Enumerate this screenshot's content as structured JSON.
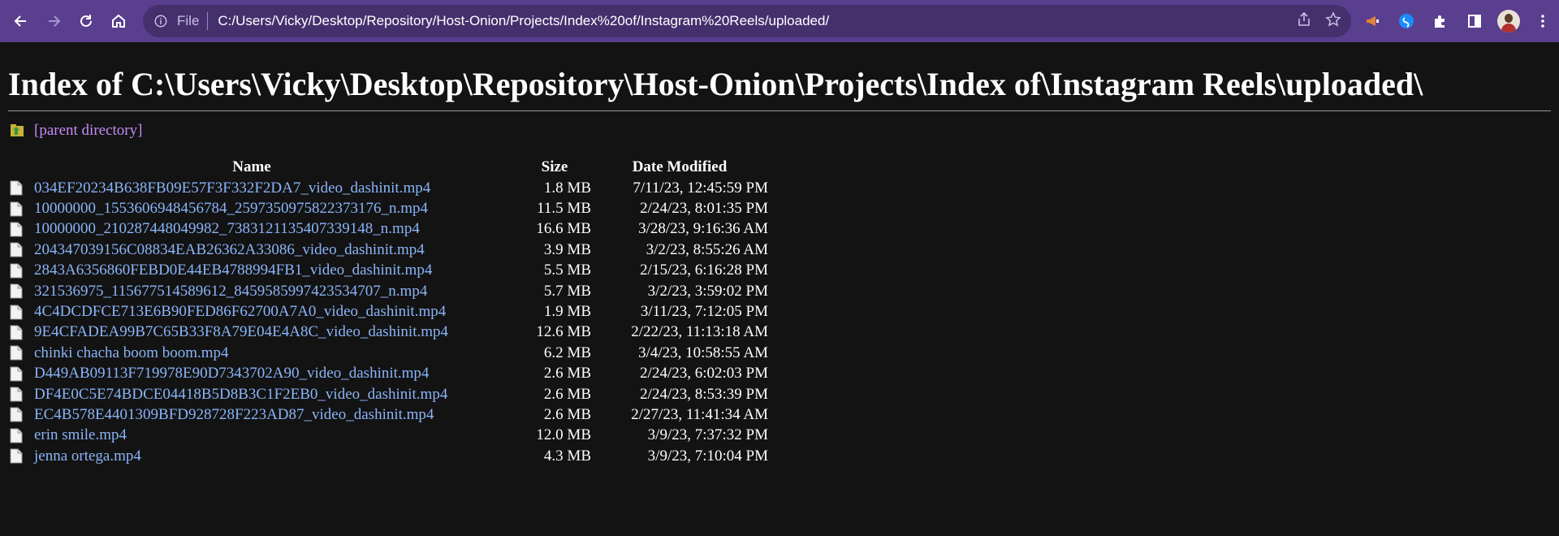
{
  "browser": {
    "url_scheme": "File",
    "url": "C:/Users/Vicky/Desktop/Repository/Host-Onion/Projects/Index%20of/Instagram%20Reels/uploaded/",
    "icons": [
      "back-icon",
      "forward-icon",
      "reload-icon",
      "home-icon",
      "info-icon",
      "share-icon",
      "star-icon",
      "extension-megaphone-icon",
      "extension-shazam-icon",
      "puzzle-icon",
      "side-panel-icon",
      "avatar",
      "kebab-menu-icon"
    ]
  },
  "page": {
    "heading": "Index of C:\\Users\\Vicky\\Desktop\\Repository\\Host-Onion\\Projects\\Index of\\Instagram Reels\\uploaded\\",
    "parent_link": "[parent directory]",
    "columns": {
      "name": "Name",
      "size": "Size",
      "date": "Date Modified"
    },
    "files": [
      {
        "name": "034EF20234B638FB09E57F3F332F2DA7_video_dashinit.mp4",
        "size": "1.8 MB",
        "date": "7/11/23, 12:45:59 PM"
      },
      {
        "name": "10000000_1553606948456784_2597350975822373176_n.mp4",
        "size": "11.5 MB",
        "date": "2/24/23, 8:01:35 PM"
      },
      {
        "name": "10000000_210287448049982_7383121135407339148_n.mp4",
        "size": "16.6 MB",
        "date": "3/28/23, 9:16:36 AM"
      },
      {
        "name": "204347039156C08834EAB26362A33086_video_dashinit.mp4",
        "size": "3.9 MB",
        "date": "3/2/23, 8:55:26 AM"
      },
      {
        "name": "2843A6356860FEBD0E44EB4788994FB1_video_dashinit.mp4",
        "size": "5.5 MB",
        "date": "2/15/23, 6:16:28 PM"
      },
      {
        "name": "321536975_115677514589612_8459585997423534707_n.mp4",
        "size": "5.7 MB",
        "date": "3/2/23, 3:59:02 PM"
      },
      {
        "name": "4C4DCDFCE713E6B90FED86F62700A7A0_video_dashinit.mp4",
        "size": "1.9 MB",
        "date": "3/11/23, 7:12:05 PM"
      },
      {
        "name": "9E4CFADEA99B7C65B33F8A79E04E4A8C_video_dashinit.mp4",
        "size": "12.6 MB",
        "date": "2/22/23, 11:13:18 AM"
      },
      {
        "name": "chinki chacha boom boom.mp4",
        "size": "6.2 MB",
        "date": "3/4/23, 10:58:55 AM"
      },
      {
        "name": "D449AB09113F719978E90D7343702A90_video_dashinit.mp4",
        "size": "2.6 MB",
        "date": "2/24/23, 6:02:03 PM"
      },
      {
        "name": "DF4E0C5E74BDCE04418B5D8B3C1F2EB0_video_dashinit.mp4",
        "size": "2.6 MB",
        "date": "2/24/23, 8:53:39 PM"
      },
      {
        "name": "EC4B578E4401309BFD928728F223AD87_video_dashinit.mp4",
        "size": "2.6 MB",
        "date": "2/27/23, 11:41:34 AM"
      },
      {
        "name": "erin smile.mp4",
        "size": "12.0 MB",
        "date": "3/9/23, 7:37:32 PM"
      },
      {
        "name": "jenna ortega.mp4",
        "size": "4.3 MB",
        "date": "3/9/23, 7:10:04 PM"
      }
    ]
  },
  "colors": {
    "toolbar": "#5a3f8f",
    "omnibox": "#45306e",
    "page_background": "#131313",
    "link": "#8ab4f8",
    "visited_link": "#c58af9"
  }
}
